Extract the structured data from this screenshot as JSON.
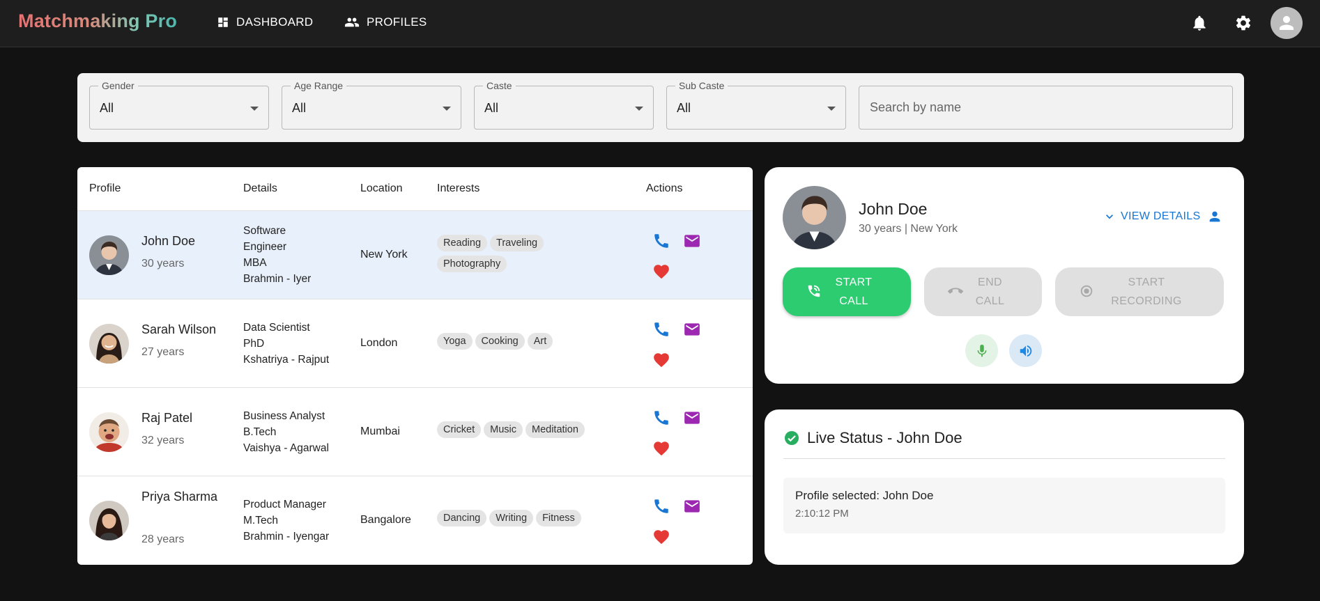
{
  "app": {
    "logo": "Matchmaking Pro",
    "nav": [
      {
        "label": "DASHBOARD",
        "icon": "dashboard-icon"
      },
      {
        "label": "PROFILES",
        "icon": "people-icon"
      }
    ],
    "icons": [
      "bell-icon",
      "gear-icon",
      "account-avatar-icon"
    ]
  },
  "filters": {
    "gender": {
      "label": "Gender",
      "value": "All"
    },
    "age_range": {
      "label": "Age Range",
      "value": "All"
    },
    "caste": {
      "label": "Caste",
      "value": "All"
    },
    "sub_caste": {
      "label": "Sub Caste",
      "value": "All"
    },
    "search": {
      "placeholder": "Search by name",
      "value": ""
    }
  },
  "table": {
    "headers": [
      "Profile",
      "Details",
      "Location",
      "Interests",
      "Actions"
    ],
    "rows": [
      {
        "name": "John Doe",
        "age": "30 years",
        "details": [
          "Software",
          "Engineer",
          "MBA",
          "Brahmin - Iyer"
        ],
        "location": "New York",
        "interests": [
          "Reading",
          "Traveling",
          "Photography"
        ],
        "selected": true
      },
      {
        "name": "Sarah Wilson",
        "age": "27 years",
        "details": [
          "Data Scientist",
          "PhD",
          "Kshatriya - Rajput"
        ],
        "location": "London",
        "interests": [
          "Yoga",
          "Cooking",
          "Art"
        ],
        "selected": false
      },
      {
        "name": "Raj Patel",
        "age": "32 years",
        "details": [
          "Business Analyst",
          "B.Tech",
          "Vaishya - Agarwal"
        ],
        "location": "Mumbai",
        "interests": [
          "Cricket",
          "Music",
          "Meditation"
        ],
        "selected": false
      },
      {
        "name": "Priya Sharma",
        "age": "28 years",
        "details": [
          "Product Manager",
          "M.Tech",
          "Brahmin - Iyengar"
        ],
        "location": "Bangalore",
        "interests": [
          "Dancing",
          "Writing",
          "Fitness"
        ],
        "selected": false
      }
    ],
    "action_icons": [
      "phone-icon",
      "email-icon",
      "heart-icon"
    ]
  },
  "call_panel": {
    "name": "John Doe",
    "subtitle": "30 years | New York",
    "view_details": "VIEW DETAILS",
    "start_call": [
      "START",
      "CALL"
    ],
    "end_call": [
      "END",
      "CALL"
    ],
    "start_recording": [
      "START",
      "RECORDING"
    ],
    "icons": [
      "mic-icon",
      "volume-icon"
    ]
  },
  "live_status": {
    "title": "Live Status - John Doe",
    "message": "Profile selected: John Doe",
    "time": "2:10:12 PM"
  },
  "colors": {
    "background": "#121212",
    "accent_blue": "#1976d2",
    "accent_green": "#2ecc71",
    "email_purple": "#9c27b0",
    "heart_red": "#e53935",
    "selected_row": "#e8f0fb"
  }
}
